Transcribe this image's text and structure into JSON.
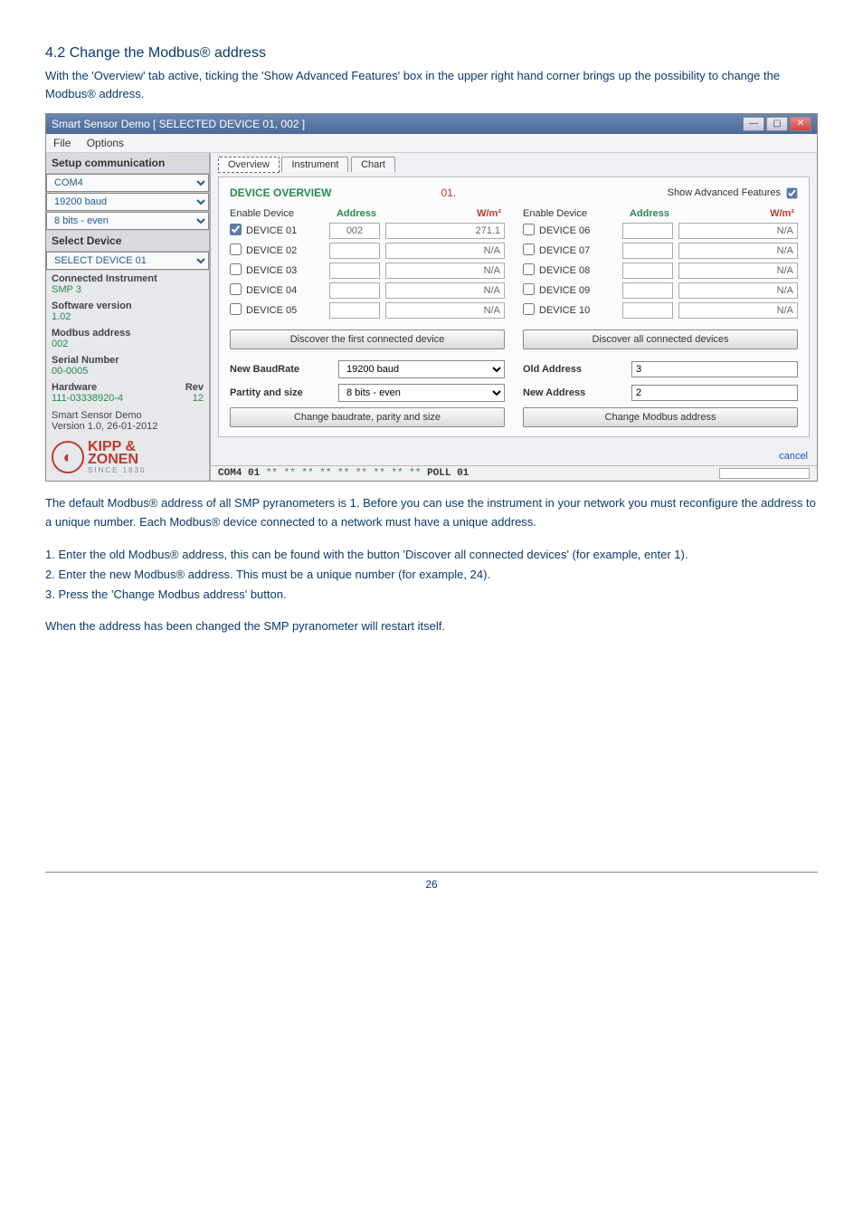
{
  "section": {
    "heading": "4.2 Change the Modbus® address"
  },
  "intro": "With the 'Overview' tab active, ticking the 'Show Advanced Features' box in the upper right hand corner brings up the possibility to change the Modbus® address.",
  "titlebar": "Smart Sensor Demo [ SELECTED DEVICE 01, 002 ]",
  "menu": {
    "file": "File",
    "options": "Options"
  },
  "sidebar": {
    "setup": "Setup communication",
    "com": "COM4",
    "baud": "19200 baud",
    "parity": "8 bits - even",
    "select_device_hdr": "Select Device",
    "select_device_val": "SELECT DEVICE 01",
    "connected_instrument_lbl": "Connected Instrument",
    "connected_instrument_val": "SMP 3",
    "software_version_lbl": "Software version",
    "software_version_val": "1.02",
    "modbus_address_lbl": "Modbus address",
    "modbus_address_val": "002",
    "serial_number_lbl": "Serial Number",
    "serial_number_val": "00-0005",
    "hardware_lbl": "Hardware",
    "rev_lbl": "Rev",
    "hardware_val": "111-03338920-4",
    "rev_val": "12",
    "demo_line1": "Smart Sensor Demo",
    "demo_line2": "Version 1.0, 26-01-2012",
    "logo1": "KIPP &",
    "logo2": "ZONEN",
    "logo3": "SINCE 1830"
  },
  "tabs": {
    "overview": "Overview",
    "instrument": "Instrument",
    "chart": "Chart"
  },
  "overview": {
    "title": "DEVICE OVERVIEW",
    "num": "01.",
    "adv_label": "Show Advanced Features",
    "enable_device": "Enable Device",
    "address": "Address",
    "wm2": "W/m²",
    "left": [
      {
        "name": "DEVICE 01",
        "checked": true,
        "addr": "002",
        "val": "271.1"
      },
      {
        "name": "DEVICE 02",
        "checked": false,
        "addr": "",
        "val": "N/A"
      },
      {
        "name": "DEVICE 03",
        "checked": false,
        "addr": "",
        "val": "N/A"
      },
      {
        "name": "DEVICE 04",
        "checked": false,
        "addr": "",
        "val": "N/A"
      },
      {
        "name": "DEVICE 05",
        "checked": false,
        "addr": "",
        "val": "N/A"
      }
    ],
    "right": [
      {
        "name": "DEVICE 06",
        "checked": false,
        "addr": "",
        "val": "N/A"
      },
      {
        "name": "DEVICE 07",
        "checked": false,
        "addr": "",
        "val": "N/A"
      },
      {
        "name": "DEVICE 08",
        "checked": false,
        "addr": "",
        "val": "N/A"
      },
      {
        "name": "DEVICE 09",
        "checked": false,
        "addr": "",
        "val": "N/A"
      },
      {
        "name": "DEVICE 10",
        "checked": false,
        "addr": "",
        "val": "N/A"
      }
    ],
    "discover_first": "Discover the first connected device",
    "discover_all": "Discover all connected devices",
    "new_baud_lbl": "New BaudRate",
    "new_baud_val": "19200 baud",
    "partity_lbl": "Partity and size",
    "partity_val": "8 bits - even",
    "old_addr_lbl": "Old Address",
    "old_addr_val": "3",
    "new_addr_lbl": "New Address",
    "new_addr_val": "2",
    "change_baud": "Change baudrate, parity and size",
    "change_modbus": "Change Modbus address",
    "cancel": "cancel"
  },
  "statusbar": {
    "left_a": "COM4  01 ",
    "dots": "** ** ** ** ** ** ** ** **",
    "poll": " POLL 01"
  },
  "after1": "The default Modbus® address of all SMP pyranometers is 1. Before you can use the instrument in your network you must reconfigure the address to a unique number. Each Modbus® device connected to a network must have a unique address.",
  "steps": {
    "s1": "1. Enter the old Modbus® address, this can be found with the button 'Discover all connected devices' (for example, enter 1).",
    "s2": "2. Enter the new Modbus® address. This must be a unique number (for example, 24).",
    "s3": "3. Press the 'Change Modbus address' button."
  },
  "after2": "When the address has been changed the SMP pyranometer will restart itself.",
  "page_number": "26"
}
